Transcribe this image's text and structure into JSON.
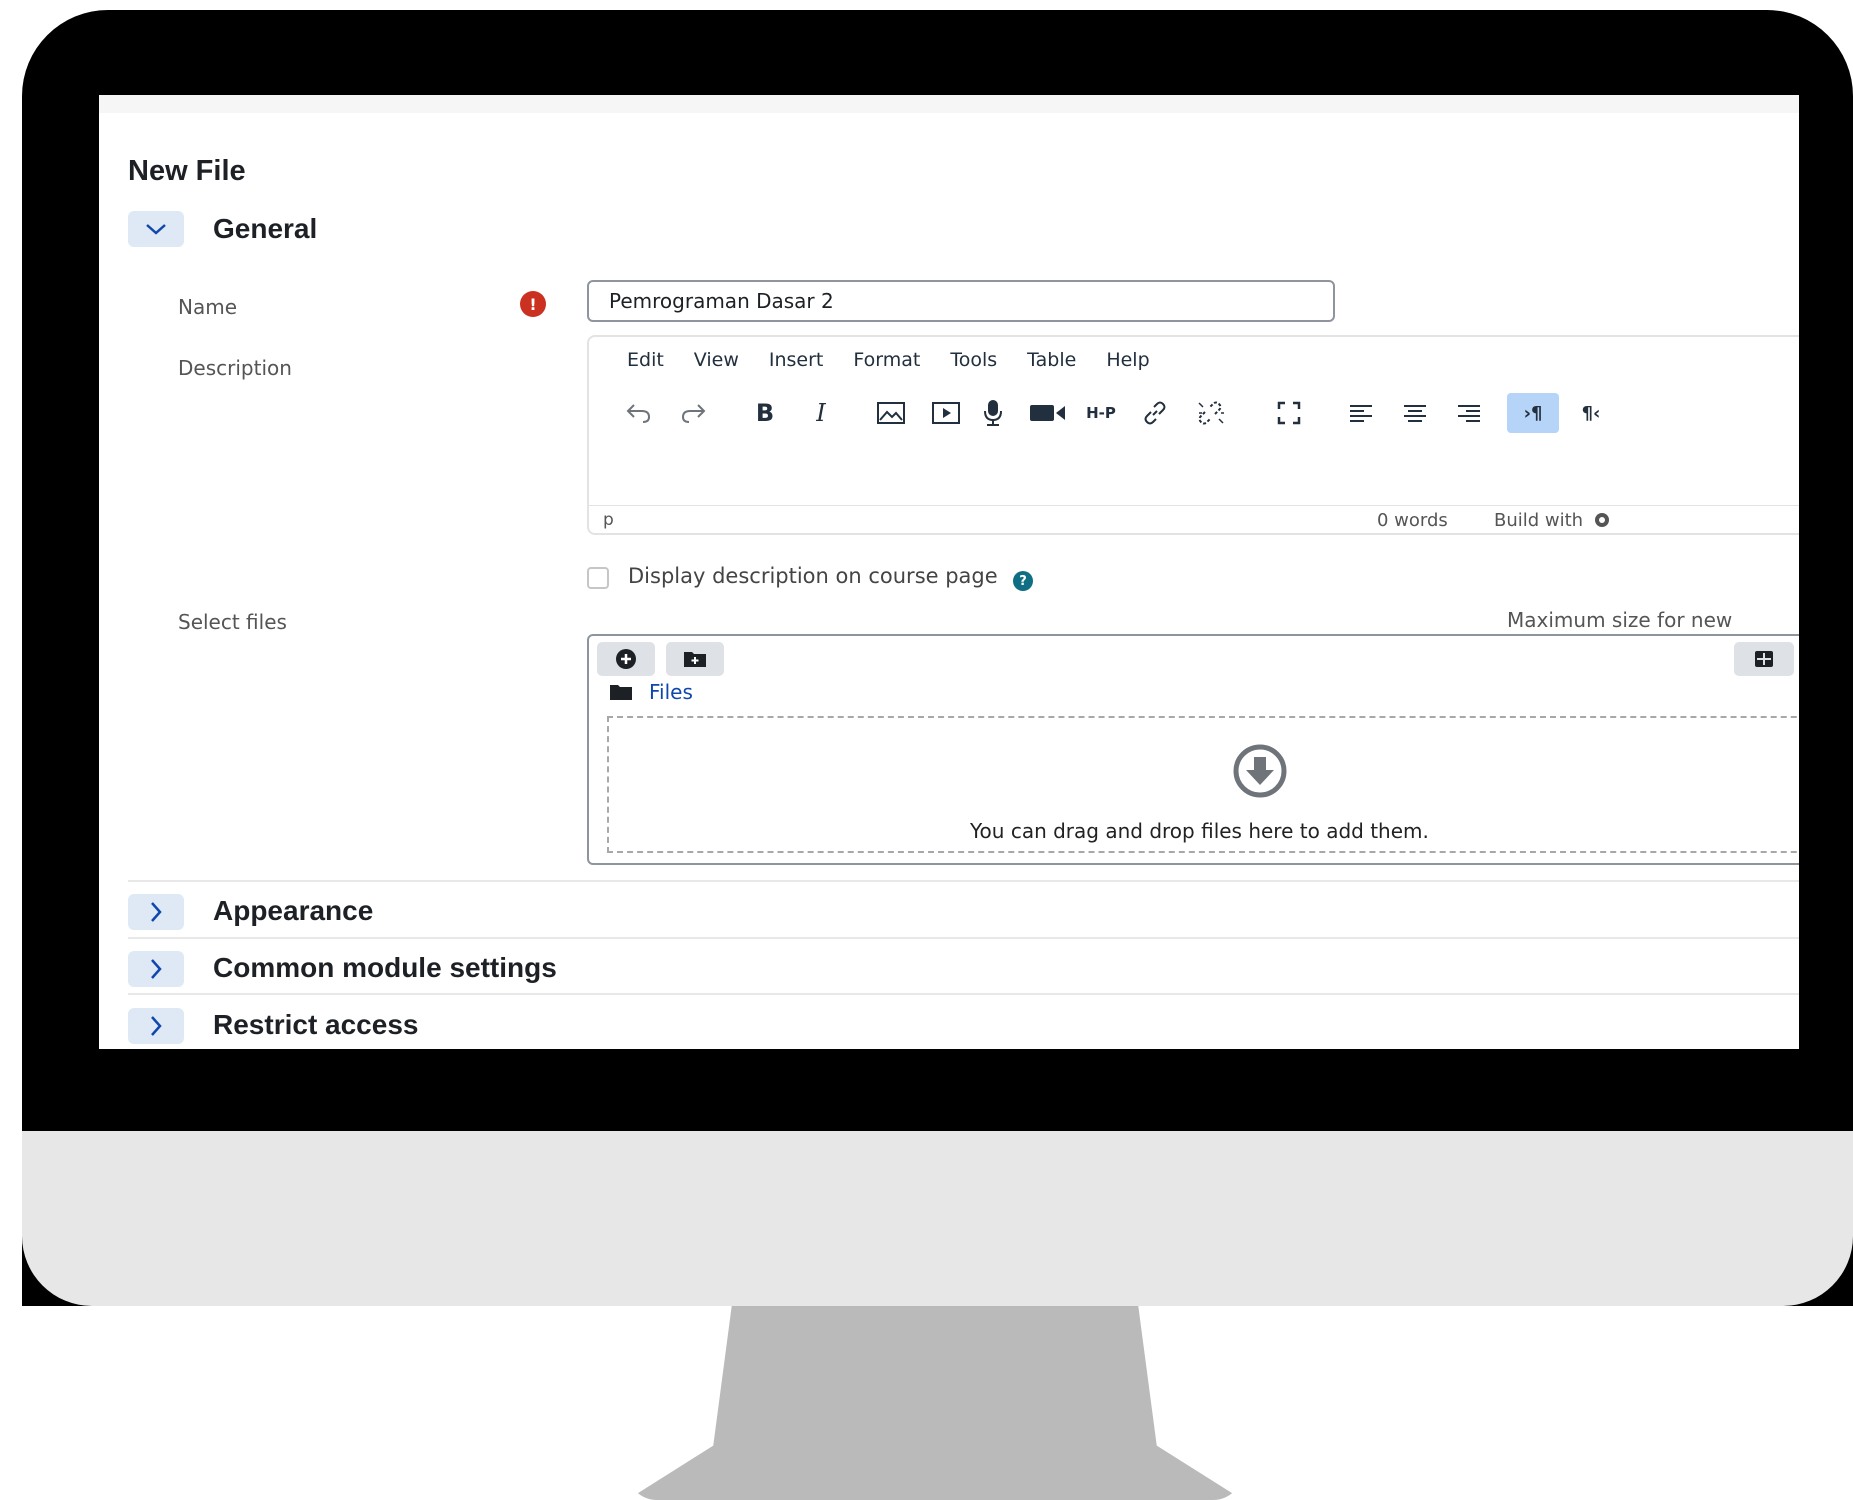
{
  "page": {
    "title": "New File"
  },
  "sections": {
    "general": {
      "title": "General",
      "toggle": "⌄"
    },
    "appearance": {
      "title": "Appearance",
      "toggle": ">"
    },
    "common": {
      "title": "Common module settings",
      "toggle": ">"
    },
    "restrict": {
      "title": "Restrict access",
      "toggle": ">"
    }
  },
  "form": {
    "name_label": "Name",
    "name_value": "Pemrograman Dasar 2",
    "required_icon": "!",
    "description_label": "Description",
    "select_files_label": "Select files"
  },
  "editor": {
    "menu": [
      "Edit",
      "View",
      "Insert",
      "Format",
      "Tools",
      "Table",
      "Help"
    ],
    "path": "p",
    "word_count": "0 words",
    "build_with": "Build with",
    "toolbar_icons": [
      "undo-icon",
      "redo-icon",
      "bold-icon",
      "italic-icon",
      "image-icon",
      "media-icon",
      "microphone-icon",
      "video-icon",
      "h5p-icon",
      "link-icon",
      "unlink-icon",
      "fullscreen-icon",
      "align-left-icon",
      "align-center-icon",
      "align-right-icon",
      "ltr-icon",
      "rtl-icon"
    ],
    "bold_label": "B",
    "italic_label": "I",
    "h5p_label": "H-P",
    "ltr_label": "›¶",
    "rtl_label": "¶‹"
  },
  "display_description": {
    "label": "Display description on course page",
    "checked": false,
    "help_icon": "?"
  },
  "filepicker": {
    "max_size": "Maximum size for new",
    "breadcrumb": "Files",
    "drop_text": "You can drag and drop files here to add them."
  },
  "colors": {
    "accent": "#0f47ad",
    "toggle_bg": "#dfe9f5",
    "required": "#ca3120",
    "help": "#0f6e84",
    "active_button": "#b5d4f8"
  }
}
